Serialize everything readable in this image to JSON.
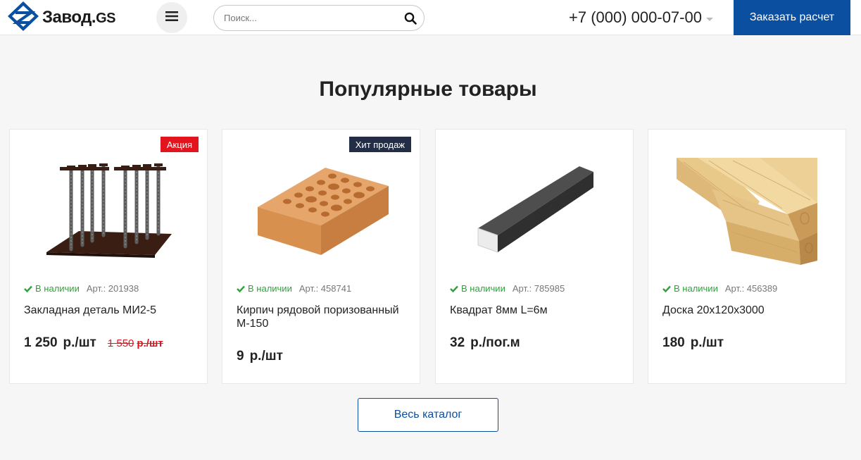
{
  "header": {
    "logo_text": "Завод.",
    "logo_text_gs": "GS",
    "search_placeholder": "Поиск...",
    "phone": "+7 (000) 000-07-00",
    "order_button": "Заказать расчет"
  },
  "section": {
    "title": "Популярные товары",
    "catalog_button": "Весь каталог"
  },
  "products": [
    {
      "badge": "Акция",
      "stock": "В наличии",
      "article": "Арт.: 201938",
      "name": "Закладная деталь МИ2-5",
      "price": "1 250",
      "unit": "р./шт",
      "old_price": "1 550",
      "old_unit": "р./шт"
    },
    {
      "badge": "Хит продаж",
      "stock": "В наличии",
      "article": "Арт.: 458741",
      "name": "Кирпич рядовой поризованный М-150",
      "price": "9",
      "unit": "р./шт"
    },
    {
      "stock": "В наличии",
      "article": "Арт.: 785985",
      "name": "Квадрат 8мм L=6м",
      "price": "32",
      "unit": "р./пог.м"
    },
    {
      "stock": "В наличии",
      "article": "Арт.: 456389",
      "name": "Доска 20x120x3000",
      "price": "180",
      "unit": "р./шт"
    }
  ],
  "colors": {
    "brand_blue": "#0a4fa0",
    "sale_red": "#e2141e",
    "hit_navy": "#232d45",
    "stock_green": "#30a13c"
  },
  "icons": [
    "logo-icon",
    "menu-icon",
    "search-icon",
    "check-icon",
    "chevron-down-icon"
  ]
}
